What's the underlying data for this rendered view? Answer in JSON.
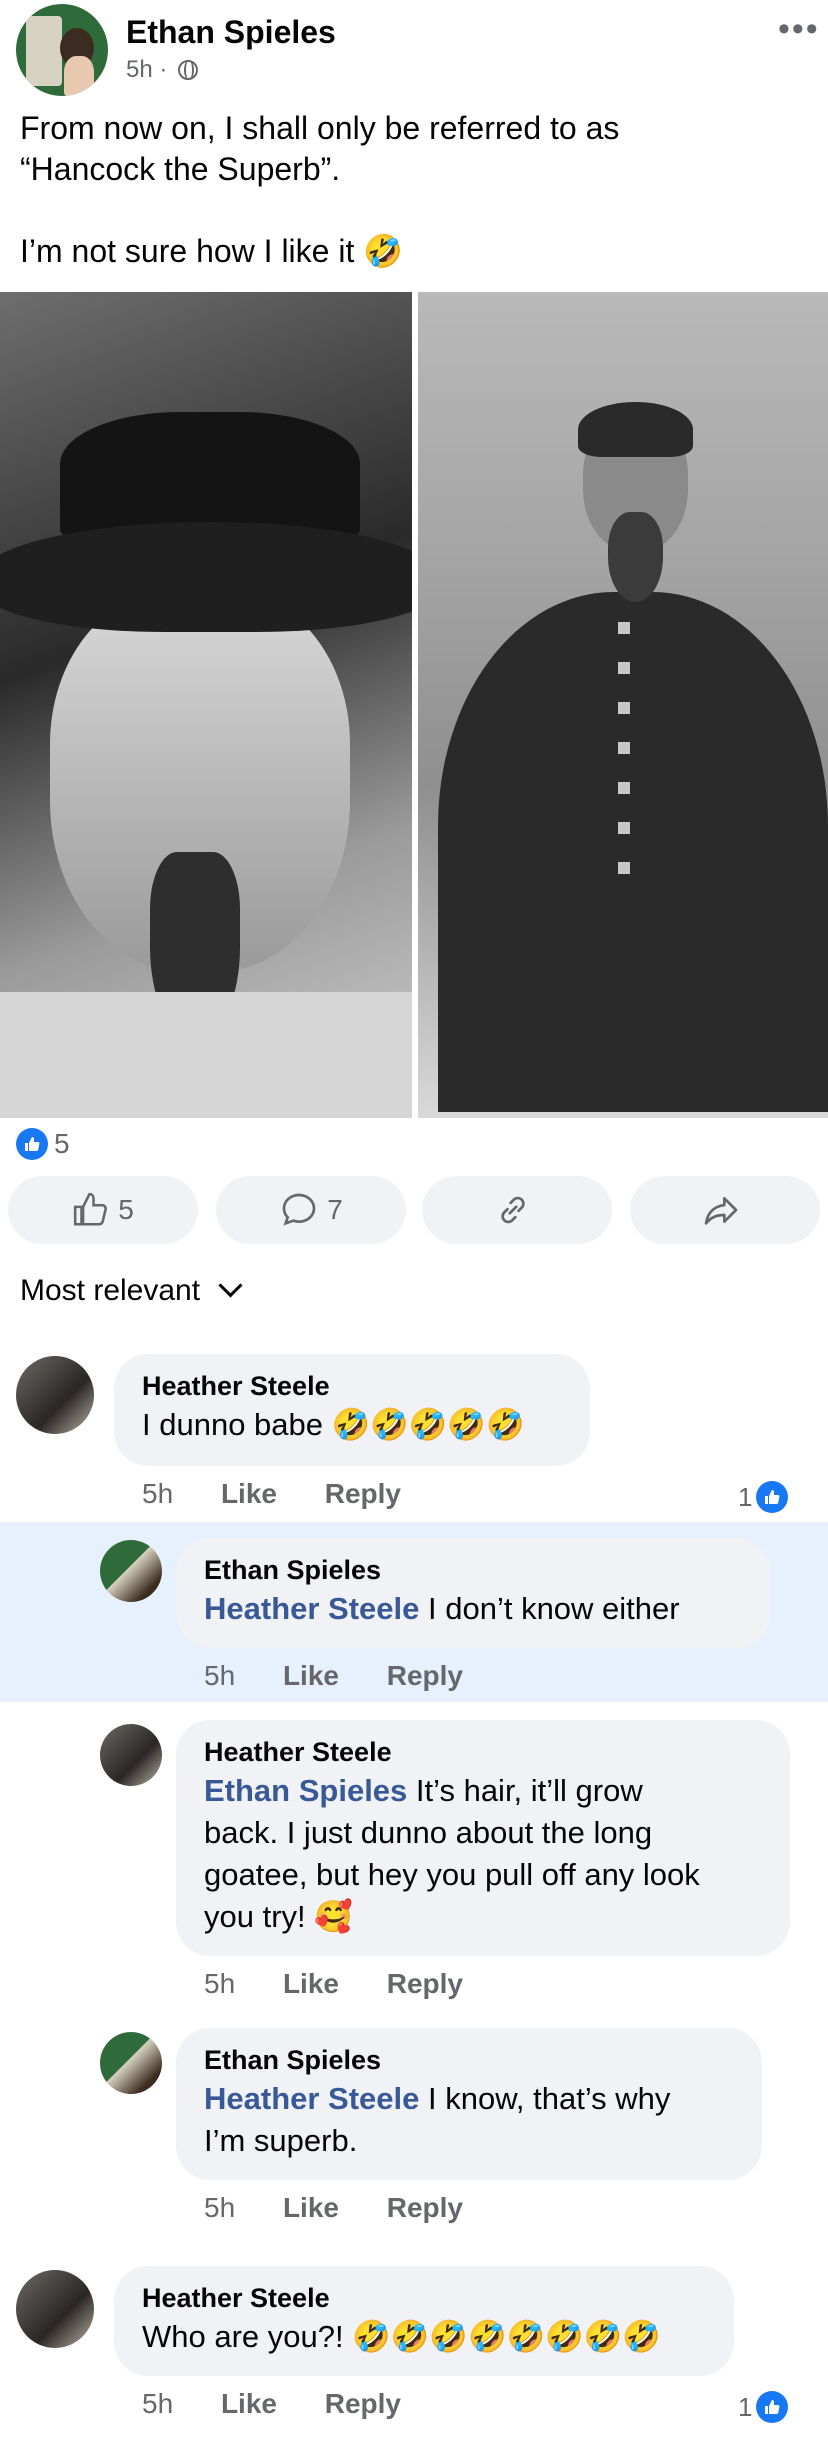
{
  "post": {
    "author": "Ethan Spieles",
    "time": "5h",
    "separator": "·",
    "more_label": "•••",
    "text_line1": "From now on, I shall only be referred to as",
    "text_line2": "“Hancock the Superb”.",
    "text_line3": "I’m not sure how I like it 🤣"
  },
  "reactions": {
    "count": "5",
    "accent": "#1877f2"
  },
  "actions": {
    "like_count": "5",
    "comment_count": "7"
  },
  "sort_label": "Most relevant",
  "comments": [
    {
      "name": "Heather Steele",
      "mention": "",
      "text": "I dunno babe 🤣🤣🤣🤣🤣",
      "time": "5h",
      "like": "Like",
      "reply": "Reply",
      "reaction_count": "1"
    },
    {
      "name": "Ethan Spieles",
      "mention": "Heather Steele",
      "text": " I don’t know either",
      "time": "5h",
      "like": "Like",
      "reply": "Reply"
    },
    {
      "name": "Heather Steele",
      "mention": "Ethan Spieles",
      "text_line1": " It’s hair, it’ll grow",
      "text_line2": "back. I just dunno about the long",
      "text_line3": "goatee, but hey you pull off any look",
      "text_line4": "you try! 🥰",
      "time": "5h",
      "like": "Like",
      "reply": "Reply"
    },
    {
      "name": "Ethan Spieles",
      "mention": "Heather Steele",
      "text_line1": " I know, that’s why",
      "text_line2": "I’m superb.",
      "time": "5h",
      "like": "Like",
      "reply": "Reply"
    },
    {
      "name": "Heather Steele",
      "mention": "",
      "text": "Who are you?! 🤣🤣🤣🤣🤣🤣🤣🤣",
      "time": "5h",
      "like": "Like",
      "reply": "Reply",
      "reaction_count": "1"
    }
  ]
}
